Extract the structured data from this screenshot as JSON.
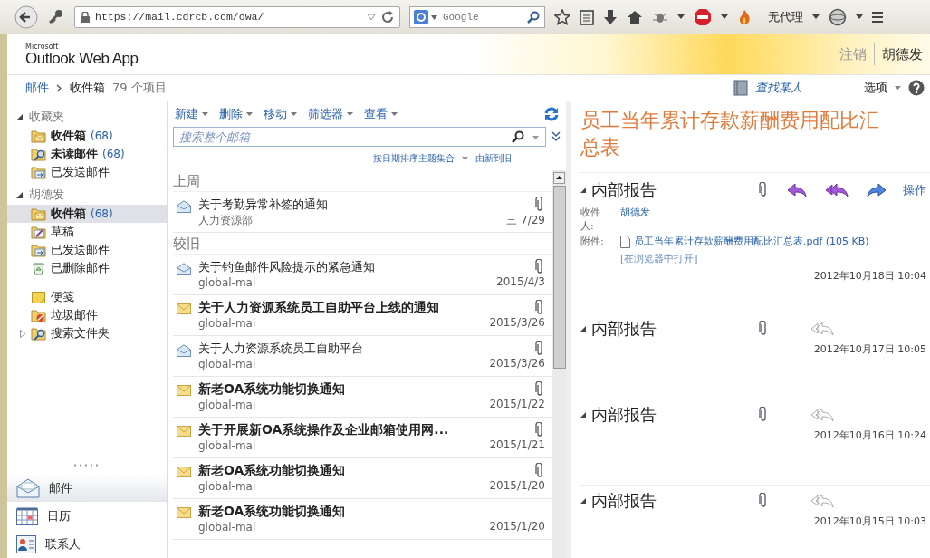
{
  "browser": {
    "url": "https://mail.cdrcb.com/owa/",
    "search_placeholder": "Google",
    "proxy": "无代理"
  },
  "header": {
    "brand_small": "Microsoft",
    "brand": "Outlook Web App",
    "sign_out": "注销",
    "user": "胡德发"
  },
  "breadcrumb": {
    "items": [
      "邮件",
      "收件箱"
    ],
    "count": "79 个项目",
    "find_people": "查找某人",
    "options": "选项"
  },
  "nav": {
    "sections": [
      {
        "title": "收藏夹",
        "expanded": true,
        "children": [
          {
            "label": "收件箱",
            "count": "(68)",
            "kind": "inbox",
            "bold": true,
            "selected": false
          },
          {
            "label": "未读邮件",
            "count": "(68)",
            "kind": "search",
            "bold": true,
            "selected": false
          },
          {
            "label": "已发送邮件",
            "kind": "sent",
            "bold": false,
            "selected": false
          }
        ]
      },
      {
        "title": "胡德发",
        "expanded": true,
        "children": [
          {
            "label": "收件箱",
            "count": "(68)",
            "kind": "inbox",
            "bold": true,
            "selected": true
          },
          {
            "label": "草稿",
            "kind": "drafts",
            "bold": false,
            "selected": false
          },
          {
            "label": "已发送邮件",
            "kind": "sent",
            "bold": false,
            "selected": false
          },
          {
            "label": "已删除邮件",
            "kind": "deleted",
            "bold": false,
            "selected": false
          },
          {
            "label": "便笺",
            "kind": "notes",
            "bold": false,
            "selected": false
          },
          {
            "label": "垃圾邮件",
            "kind": "junk",
            "bold": false,
            "selected": false
          },
          {
            "label": "搜索文件夹",
            "kind": "search",
            "bold": false,
            "selected": false,
            "expanded": false
          }
        ]
      }
    ],
    "modules": [
      {
        "label": "邮件",
        "kind": "mail",
        "selected": true
      },
      {
        "label": "日历",
        "kind": "calendar",
        "selected": false
      },
      {
        "label": "联系人",
        "kind": "contacts",
        "selected": false
      }
    ]
  },
  "toolbar": [
    "新建",
    "删除",
    "移动",
    "筛选器",
    "查看"
  ],
  "search": {
    "placeholder": "搜索整个邮箱"
  },
  "sort": {
    "by": "按日期排序主题集合",
    "order": "由新到旧"
  },
  "groups": [
    {
      "title": "上周",
      "messages": [
        {
          "subject": "关于考勤异常补签的通知",
          "sender": "人力资源部",
          "date": "三 7/29",
          "unread": false,
          "attachment": true
        }
      ]
    },
    {
      "title": "较旧",
      "messages": [
        {
          "subject": "关于钓鱼邮件风险提示的紧急通知",
          "sender": "global-mai",
          "date": "2015/4/3",
          "unread": false,
          "attachment": true
        },
        {
          "subject": "关于人力资源系统员工自助平台上线的通知",
          "sender": "global-mai",
          "date": "2015/3/26",
          "unread": true,
          "attachment": true
        },
        {
          "subject": "关于人力资源系统员工自助平台",
          "sender": "global-mai",
          "date": "2015/3/26",
          "unread": false,
          "attachment": true
        },
        {
          "subject": "新老OA系统功能切换通知",
          "sender": "global-mai",
          "date": "2015/1/22",
          "unread": true,
          "attachment": true
        },
        {
          "subject": "关于开展新OA系统操作及企业邮箱使用网...",
          "sender": "global-mai",
          "date": "2015/1/21",
          "unread": true,
          "attachment": true
        },
        {
          "subject": "新老OA系统功能切换通知",
          "sender": "global-mai",
          "date": "2015/1/20",
          "unread": true,
          "attachment": true
        },
        {
          "subject": "新老OA系统功能切换通知",
          "sender": "global-mai",
          "date": "2015/1/20",
          "unread": true,
          "attachment": false
        }
      ]
    }
  ],
  "reading": {
    "title": "员工当年累计存款薪酬费用配比汇总表",
    "items": [
      {
        "kind": "full",
        "subject": "内部报告",
        "expanded": true,
        "attachment": true,
        "actions_label": "操作",
        "to_label": "收件人:",
        "to": "胡德发",
        "attach_label": "附件:",
        "file": "员工当年累计存款薪酬费用配比汇总表.pdf (105 KB)",
        "open_link": "[在浏览器中打开]",
        "date": "2012年10月18日 10:04"
      },
      {
        "kind": "collapsed",
        "subject": "内部报告",
        "expanded": true,
        "attachment": true,
        "date": "2012年10月17日 10:05"
      },
      {
        "kind": "collapsed",
        "subject": "内部报告",
        "expanded": true,
        "attachment": true,
        "date": "2012年10月16日 10:24"
      },
      {
        "kind": "collapsed",
        "subject": "内部报告",
        "expanded": true,
        "attachment": true,
        "date": "2012年10月15日 10:03"
      }
    ]
  }
}
